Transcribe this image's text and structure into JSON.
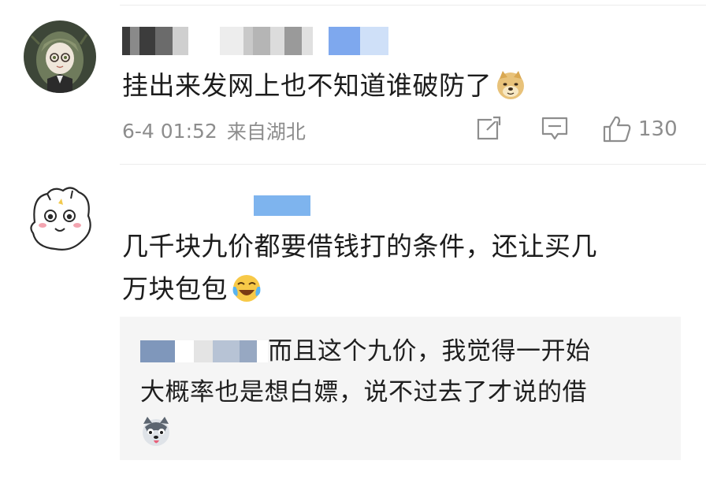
{
  "comment1": {
    "text": "挂出来发网上也不知道谁破防了",
    "emoji": "doge-emoji",
    "time": "6-4 01:52",
    "location": "来自湖北",
    "like_count": "130"
  },
  "comment2": {
    "text_line1": "几千块九价都要借钱打的条件，还让买几",
    "text_line2": "万块包包",
    "emoji": "laugh-cry-emoji"
  },
  "reply": {
    "text_line1": "而且这个九价，我觉得一开始",
    "text_line2": "大概率也是想白嫖，说不过去了才说的借",
    "emoji": "husky-emoji"
  },
  "icons": {
    "share": "share-icon",
    "comment": "comment-icon",
    "like": "thumbs-up-icon"
  },
  "colors": {
    "meta_gray": "#8d8d8d",
    "reply_bg": "#f5f5f5",
    "divider": "#ececec"
  }
}
